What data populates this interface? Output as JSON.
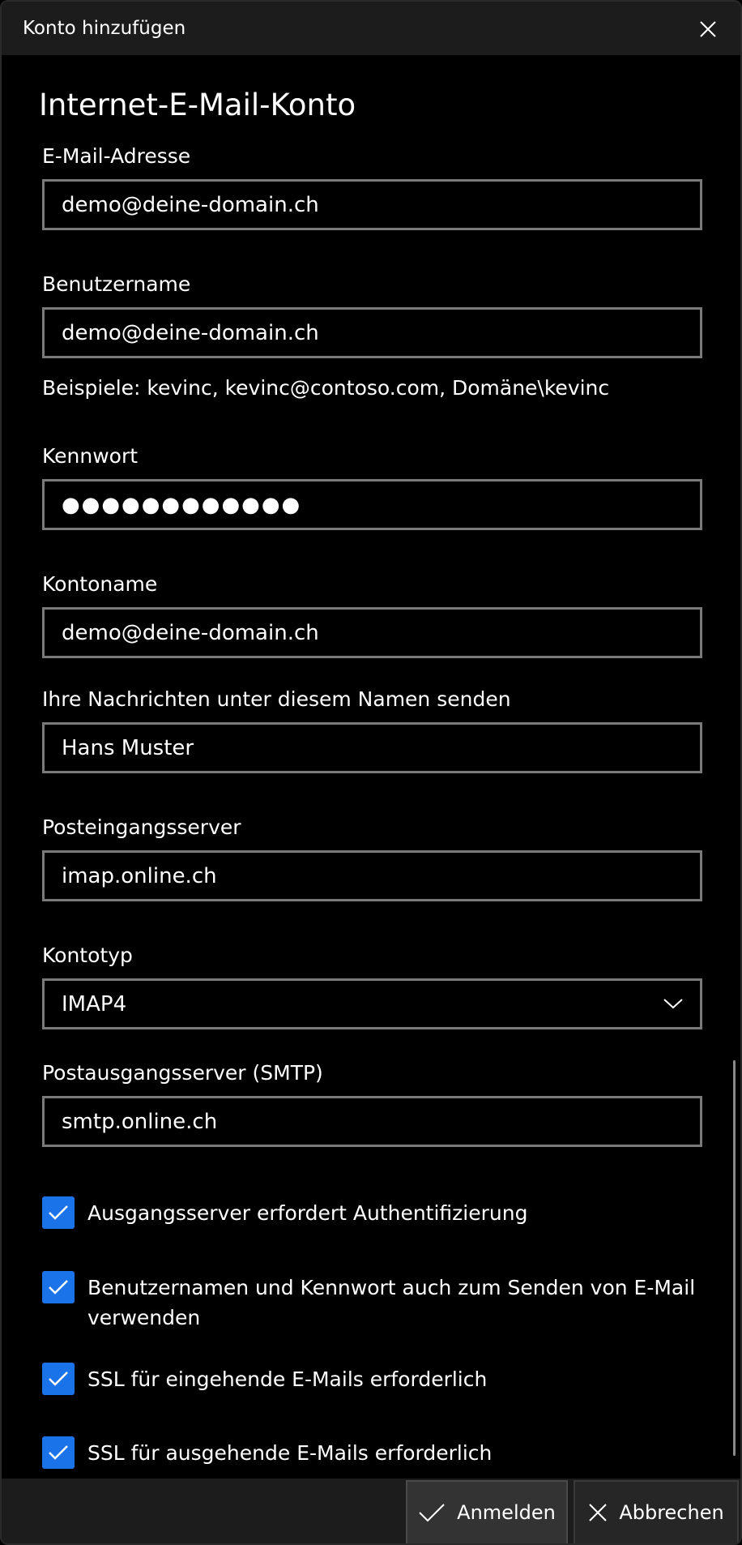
{
  "window": {
    "title": "Konto hinzufügen",
    "close_icon": "close-icon"
  },
  "form": {
    "heading": "Internet-E-Mail-Konto",
    "email": {
      "label": "E-Mail-Adresse",
      "value": "demo@deine-domain.ch"
    },
    "username": {
      "label": "Benutzername",
      "value": "demo@deine-domain.ch",
      "hint": "Beispiele: kevinc, kevinc@contoso.com, Domäne\\kevinc"
    },
    "password": {
      "label": "Kennwort",
      "value": "●●●●●●●●●●●●"
    },
    "account_name": {
      "label": "Kontoname",
      "value": "demo@deine-domain.ch"
    },
    "sender_name": {
      "label": "Ihre Nachrichten unter diesem Namen senden",
      "value": "Hans Muster"
    },
    "incoming_server": {
      "label": "Posteingangsserver",
      "value": "imap.online.ch"
    },
    "account_type": {
      "label": "Kontotyp",
      "value": "IMAP4"
    },
    "outgoing_server": {
      "label": "Postausgangsserver (SMTP)",
      "value": "smtp.online.ch"
    },
    "checkboxes": [
      {
        "label": "Ausgangsserver erfordert Authentifizierung",
        "checked": true
      },
      {
        "label": "Benutzernamen und Kennwort auch zum Senden von E-Mail verwenden",
        "checked": true
      },
      {
        "label": "SSL für eingehende E-Mails erforderlich",
        "checked": true
      },
      {
        "label": "SSL für ausgehende E-Mails erforderlich",
        "checked": true
      }
    ]
  },
  "footer": {
    "signin_label": "Anmelden",
    "cancel_label": "Abbrechen"
  },
  "colors": {
    "background": "#000000",
    "titlebar": "#1c1c1c",
    "field_border": "#7a7a7a",
    "checkbox_accent": "#1a73e8"
  }
}
